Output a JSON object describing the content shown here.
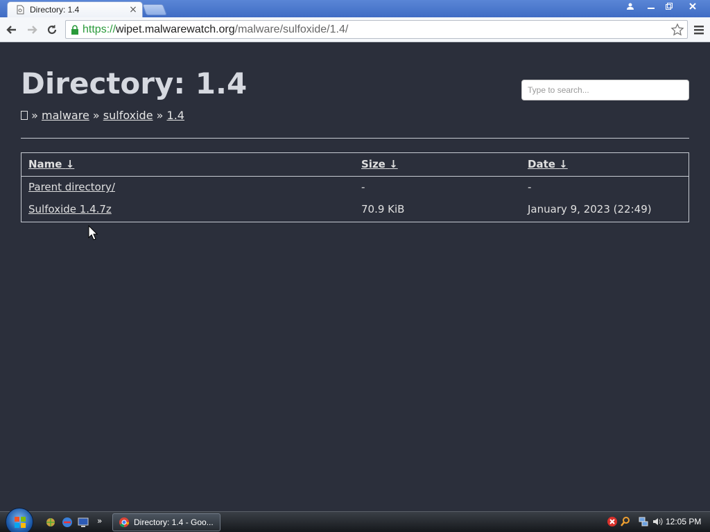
{
  "browser": {
    "tab_title": "Directory: 1.4",
    "url_scheme": "https://",
    "url_host": "wipet.malwarewatch.org",
    "url_path": "/malware/sulfoxide/1.4/"
  },
  "page": {
    "title": "Directory: 1.4",
    "search_placeholder": "Type to search...",
    "breadcrumb": {
      "separator": "»",
      "items": [
        "malware",
        "sulfoxide",
        "1.4"
      ]
    },
    "table": {
      "headers": [
        {
          "label": "Name",
          "sort": "↓"
        },
        {
          "label": "Size",
          "sort": "↓"
        },
        {
          "label": "Date",
          "sort": "↓"
        }
      ],
      "rows": [
        {
          "name": "Parent directory/",
          "size": "-",
          "date": "-"
        },
        {
          "name": "Sulfoxide 1.4.7z",
          "size": "70.9 KiB",
          "date": "January 9, 2023 (22:49)"
        }
      ]
    }
  },
  "taskbar": {
    "task_label": "Directory: 1.4 - Goo...",
    "clock": "12:05 PM",
    "quick_launch_chevron": "»"
  },
  "colors": {
    "page_bg": "#2b2f3b",
    "title_color": "#d6d9e0",
    "secure_green": "#2a9a3a"
  }
}
